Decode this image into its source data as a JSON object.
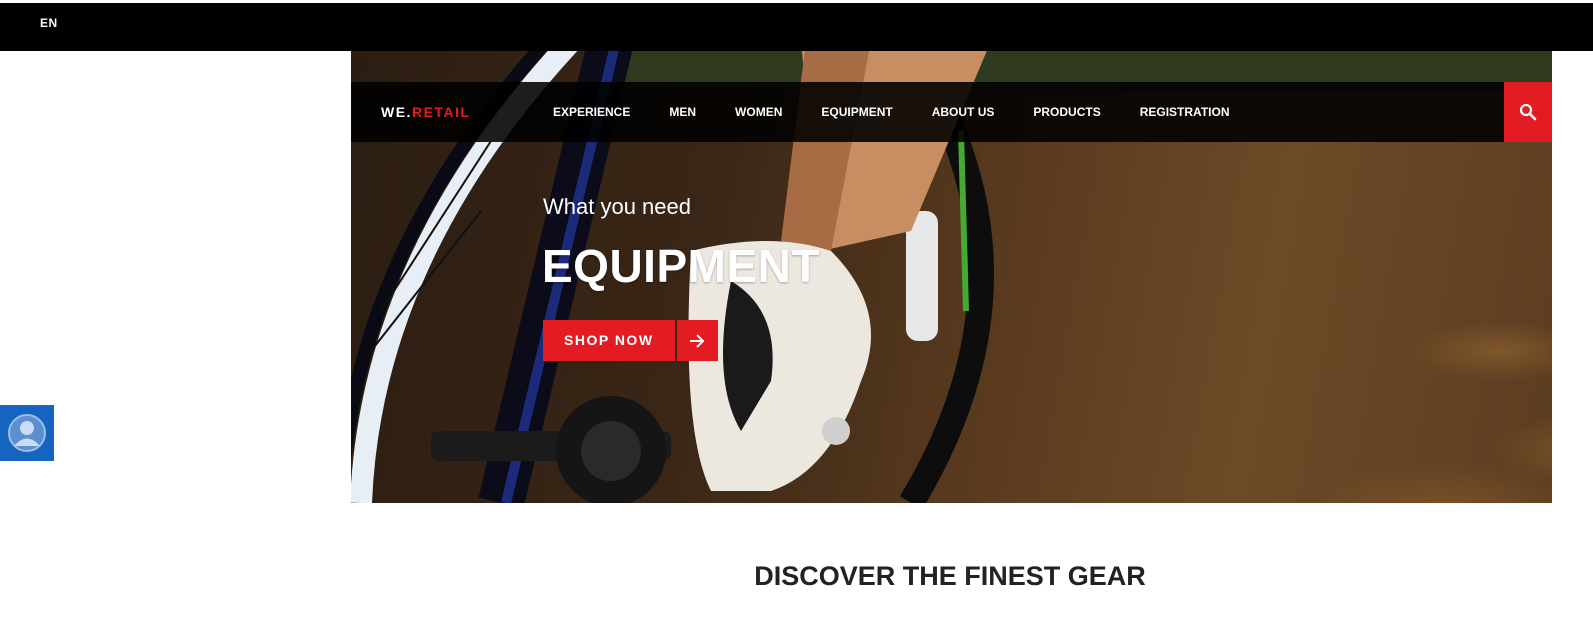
{
  "topbar": {
    "language": "EN"
  },
  "brand": {
    "part1": "WE.",
    "part2": "RETAIL"
  },
  "nav": {
    "items": [
      "EXPERIENCE",
      "MEN",
      "WOMEN",
      "EQUIPMENT",
      "ABOUT US",
      "PRODUCTS",
      "REGISTRATION"
    ]
  },
  "hero": {
    "subtitle": "What you need",
    "title": "EQUIPMENT",
    "cta_label": "SHOP NOW"
  },
  "section": {
    "title": "DISCOVER THE FINEST GEAR"
  },
  "icons": {
    "search": "search-icon",
    "arrow": "arrow-right-icon",
    "user": "user-avatar-icon"
  },
  "colors": {
    "accent": "#e31b23",
    "topbar": "#000000",
    "user_widget": "#1565c0"
  }
}
